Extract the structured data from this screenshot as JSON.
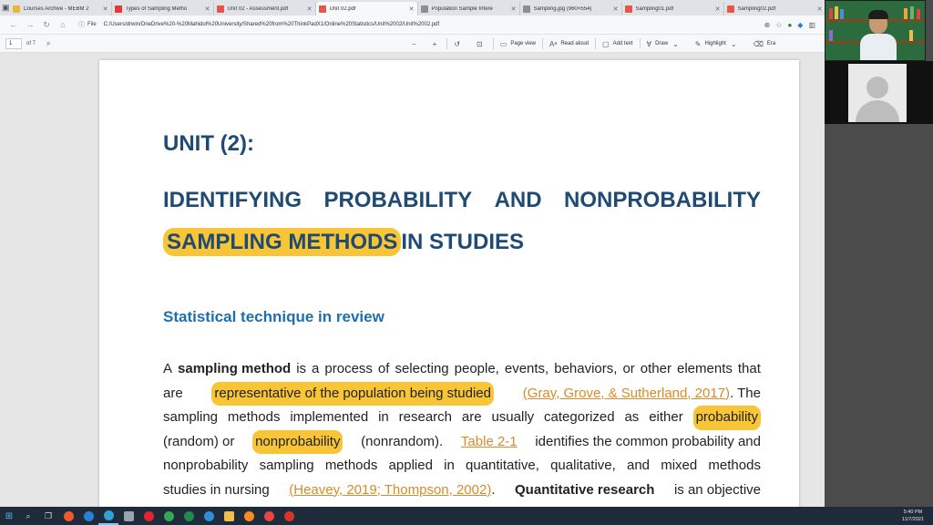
{
  "browser": {
    "tabs": [
      {
        "label": "Courses Archive - MEBM 2",
        "color": "#e8b63a"
      },
      {
        "label": "Types of Sampling Metho",
        "color": "#e53935"
      },
      {
        "label": "Unit 02 - Assessment.pdf",
        "color": "#e05a47"
      },
      {
        "label": "Unit 02.pdf",
        "color": "#e05a47"
      },
      {
        "label": "Population Sample Infere",
        "color": "#8a8f95"
      },
      {
        "label": "Sampling.jpg (960×554)",
        "color": "#8a8f95"
      },
      {
        "label": "Sampling01.pdf",
        "color": "#e05a47"
      },
      {
        "label": "Sampling02.pdf",
        "color": "#e05a47"
      }
    ],
    "url_prefix": "File",
    "url": "C:/Users/drwin/OneDrive%20-%20Mahidol%20University/Shared%20from%20ThinkPadX1/Online%20Statistics/Unit%2002/Unit%2002.pdf"
  },
  "pdf_toolbar": {
    "page_number": "1",
    "page_total": "of 7",
    "page_view": "Page view",
    "read_aloud": "Read aloud",
    "add_text": "Add text",
    "draw": "Draw",
    "highlight": "Highlight",
    "erase": "Era"
  },
  "document": {
    "unit_heading": "UNIT (2):",
    "title_line1": [
      "IDENTIFYING",
      "PROBABILITY",
      "AND",
      "NONPROBABILITY"
    ],
    "title_highlight": "SAMPLING METHODS",
    "title_rest": "IN STUDIES",
    "section_title": "Statistical technique in review",
    "para": {
      "l1_a": "A",
      "l1_bold": "sampling method",
      "l1_words": [
        "is",
        "a",
        "process",
        "of",
        "selecting",
        "people,",
        "events,",
        "behaviors,",
        "or",
        "other",
        "elements",
        "that"
      ],
      "l2_a": "are",
      "l2_hl": "representative of the population being studied",
      "l2_cite": "(Gray, Grove, & Sutherland, 2017)",
      "l2_b": ". The",
      "l3_words": [
        "sampling",
        "methods",
        "implemented",
        "in",
        "research",
        "are",
        "usually",
        "categorized",
        "as",
        "either"
      ],
      "l3_hl": "probability",
      "l4_a": "(random) or",
      "l4_hl": "nonprobability",
      "l4_b": "(nonrandom).",
      "l4_link": "Table 2-1",
      "l4_c": "identifies the common probability and",
      "l5_words": [
        "nonprobability",
        "sampling",
        "methods",
        "applied",
        "in",
        "quantitative,",
        "qualitative,",
        "and",
        "mixed",
        "methods"
      ],
      "l6_a": "studies in nursing",
      "l6_cite": "(Heavey, 2019; Thompson, 2002)",
      "l6_b": ".",
      "l6_bold": "Quantitative research",
      "l6_c": "is an objective"
    }
  },
  "taskbar": {
    "apps": [
      {
        "name": "brave-icon",
        "color": "#f05a28"
      },
      {
        "name": "mail-icon",
        "color": "#2a7fd4"
      },
      {
        "name": "edge-icon",
        "color": "#2fa3d6"
      },
      {
        "name": "store-icon",
        "color": "#9aa3ad"
      },
      {
        "name": "opera-icon",
        "color": "#e0262d"
      },
      {
        "name": "chrome-icon",
        "color": "#34a853"
      },
      {
        "name": "excel-icon",
        "color": "#1f8c4e"
      },
      {
        "name": "teams-icon",
        "color": "#2c8fd6"
      },
      {
        "name": "folder-icon",
        "color": "#f2c04a"
      },
      {
        "name": "firefox-icon",
        "color": "#ff8a1f"
      },
      {
        "name": "chrome-2-icon",
        "color": "#e8453c"
      },
      {
        "name": "recorder-icon",
        "color": "#d8352a"
      }
    ],
    "time": "5:40 PM",
    "date": "11/7/2021"
  }
}
